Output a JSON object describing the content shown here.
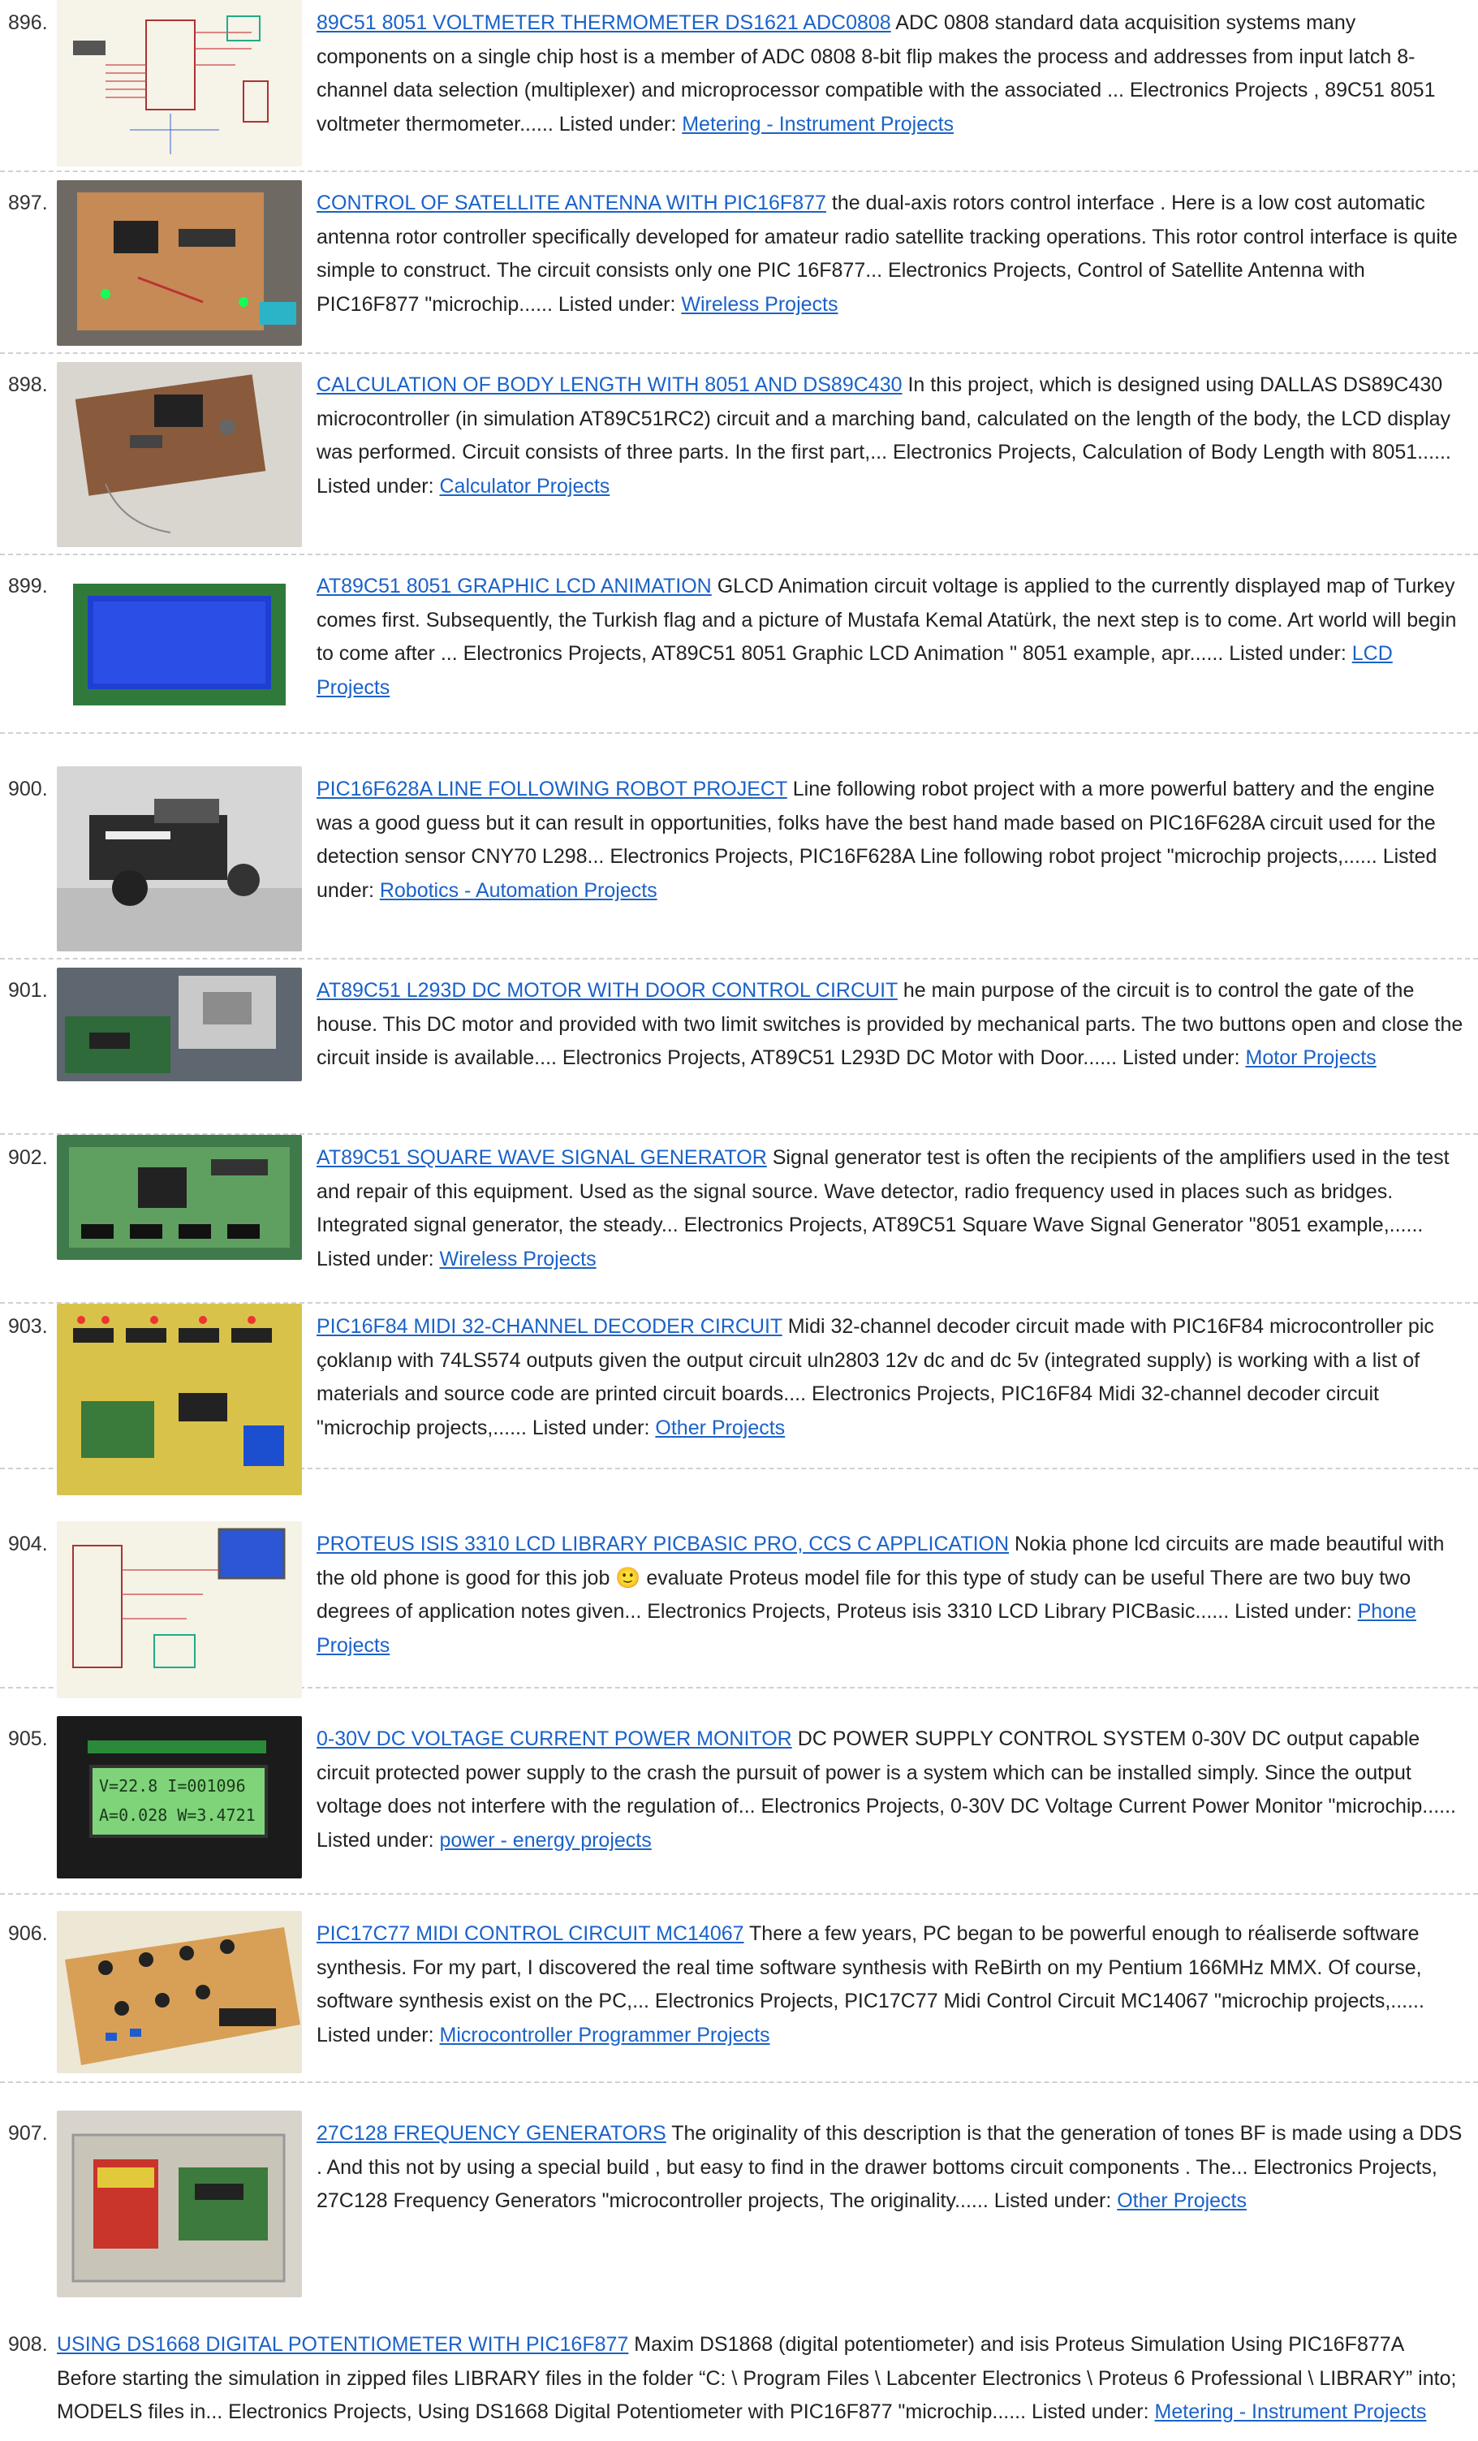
{
  "listed_prefix": "Listed under:",
  "entries": [
    {
      "num": "896.",
      "title": "89C51 8051 VOLTMETER THERMOMETER DS1621 ADC0808",
      "desc": "ADC 0808 standard data acquisition systems many components on a single chip host is a member of ADC 0808 8-bit flip makes the process and addresses from input latch 8-channel data selection (multiplexer) and microprocessor compatible with the associated ... Electronics Projects , 89C51 8051 voltmeter thermometer......",
      "category": "Metering - Instrument Projects",
      "thumb_icon": "schematic-thumbnail"
    },
    {
      "num": "897.",
      "title": "CONTROL OF SATELLITE ANTENNA WITH PIC16F877",
      "desc": "the dual-axis rotors control interface . Here is a low cost automatic antenna rotor controller specifically developed for amateur radio satellite tracking operations. This rotor control interface is quite simple to construct. The circuit consists only one PIC 16F877... Electronics Projects, Control of Satellite Antenna with PIC16F877 \"microchip......",
      "category": "Wireless Projects",
      "thumb_icon": "circuit-board-thumbnail"
    },
    {
      "num": "898.",
      "title": "CALCULATION OF BODY LENGTH WITH 8051 AND DS89C430",
      "desc": "In this project, which is designed using DALLAS DS89C430 microcontroller (in simulation AT89C51RC2) circuit and a marching band, calculated on the length of the body, the LCD display was performed. Circuit consists of three parts. In the first part,... Electronics Projects, Calculation of Body Length with 8051......",
      "category": "Calculator Projects",
      "thumb_icon": "circuit-board-thumbnail"
    },
    {
      "num": "899.",
      "title": "AT89C51 8051 GRAPHIC LCD ANIMATION",
      "desc": "GLCD Animation circuit voltage is applied to the currently displayed map of Turkey comes first. Subsequently, the Turkish flag and a picture of Mustafa Kemal Atatürk, the next step is to come. Art world will begin to come after ... Electronics Projects, AT89C51 8051 Graphic LCD Animation \" 8051 example, apr......",
      "category": "LCD Projects",
      "thumb_icon": "lcd-display-thumbnail"
    },
    {
      "num": "900.",
      "title": "PIC16F628A LINE FOLLOWING ROBOT PROJECT",
      "desc": "Line following robot project with a more powerful battery and the engine was a good guess but it can result in opportunities, folks have the best hand made based on PIC16F628A circuit used for the detection sensor CNY70 L298... Electronics Projects, PIC16F628A Line following robot project \"microchip projects,......",
      "category": "Robotics - Automation Projects",
      "thumb_icon": "robot-thumbnail"
    },
    {
      "num": "901.",
      "title": "AT89C51 L293D DC MOTOR WITH DOOR CONTROL CIRCUIT",
      "desc": "he main purpose of the circuit is to control the gate of the house. This DC motor and provided with two limit switches is provided by mechanical parts. The two buttons open and close the circuit inside is available.... Electronics Projects, AT89C51 L293D DC Motor with Door......",
      "category": "Motor Projects",
      "thumb_icon": "motor-thumbnail"
    },
    {
      "num": "902.",
      "title": "AT89C51 SQUARE WAVE SIGNAL GENERATOR",
      "desc": "Signal generator test is often the recipients of the amplifiers used in the test and repair of this equipment. Used as the signal source. Wave detector, radio frequency used in places such as bridges. Integrated signal generator, the steady... Electronics Projects, AT89C51 Square Wave Signal Generator \"8051 example,......",
      "category": "Wireless Projects",
      "thumb_icon": "green-pcb-thumbnail"
    },
    {
      "num": "903.",
      "title": "PIC16F84 MIDI 32-CHANNEL DECODER CIRCUIT",
      "desc": "Midi 32-channel decoder circuit made with PIC16F84 microcontroller pic çoklanıp with 74LS574 outputs given the output circuit uln2803 12v dc and dc 5v (integrated supply) is working with a list of materials and source code are printed circuit boards.... Electronics Projects, PIC16F84 Midi 32-channel decoder circuit \"microchip projects,......",
      "category": "Other Projects",
      "thumb_icon": "yellow-pcb-thumbnail"
    },
    {
      "num": "904.",
      "title": "PROTEUS ISIS 3310 LCD LIBRARY PICBASIC PRO, CCS C APPLICATION",
      "desc": "Nokia phone lcd circuits are made beautiful with the old phone is good for this job 🙂 evaluate Proteus model file for this type of study can be useful There are two buy two degrees of application notes given... Electronics Projects, Proteus isis 3310 LCD Library PICBasic......",
      "category": "Phone Projects",
      "thumb_icon": "schematic-thumbnail"
    },
    {
      "num": "905.",
      "title": "0-30V DC VOLTAGE CURRENT POWER MONITOR",
      "desc": "DC POWER SUPPLY CONTROL SYSTEM 0-30V DC output capable circuit protected power supply to the crash the pursuit of power is a system which can be installed simply. Since the output voltage does not interfere with the regulation of... Electronics Projects, 0-30V DC Voltage Current Power Monitor \"microchip......",
      "category": "power - energy projects",
      "thumb_icon": "power-monitor-thumbnail",
      "lcd_line1": "V=22.8  I=001096",
      "lcd_line2": "A=0.028 W=3.4721"
    },
    {
      "num": "906.",
      "title": "PIC17C77 MIDI CONTROL CIRCUIT MC14067",
      "desc": "There a few years, PC began to be powerful enough to réaliserde software synthesis. For my part, I discovered the real time software synthesis with ReBirth on my Pentium 166MHz MMX. Of course, software synthesis exist on the PC,... Electronics Projects, PIC17C77 Midi Control Circuit MC14067 \"microchip projects,......",
      "category": "Microcontroller Programmer Projects",
      "thumb_icon": "knobs-board-thumbnail"
    },
    {
      "num": "907.",
      "title": "27C128 FREQUENCY GENERATORS",
      "desc": "The originality of this description is that the generation of tones BF is made using a DDS . And this not by using a special build , but easy to find in the drawer bottoms circuit components . The... Electronics Projects, 27C128 Frequency Generators \"microcontroller projects, The originality......",
      "category": "Other Projects",
      "thumb_icon": "battery-box-thumbnail"
    },
    {
      "num": "908.",
      "title": "USING DS1668 DIGITAL POTENTIOMETER WITH PIC16F877",
      "desc": "Maxim DS1868 (digital potentiometer) and isis Proteus Simulation Using PIC16F877A Before starting the simulation in zipped files LIBRARY files in the folder “C: \\ Program Files \\ Labcenter Electronics \\ Proteus 6 Professional \\ LIBRARY” into; MODELS files in... Electronics Projects, Using DS1668 Digital Potentiometer with PIC16F877 \"microchip......",
      "category": "Metering - Instrument Projects"
    }
  ]
}
